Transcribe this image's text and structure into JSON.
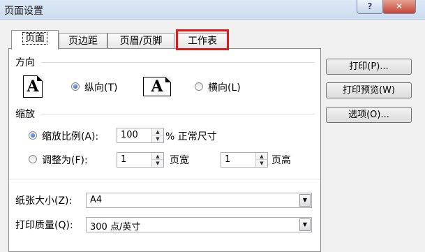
{
  "window": {
    "title": "页面设置",
    "help_label": "?",
    "close_label": "✕"
  },
  "tabs": [
    {
      "label": "页面",
      "selected": true
    },
    {
      "label": "页边距",
      "selected": false
    },
    {
      "label": "页眉/页脚",
      "selected": false
    },
    {
      "label": "工作表",
      "selected": false,
      "highlighted": true
    }
  ],
  "orientation": {
    "title": "方向",
    "icon_glyph": "A",
    "portrait_label": "纵向(T)",
    "landscape_label": "横向(L)",
    "selected": "portrait"
  },
  "scaling": {
    "title": "缩放",
    "adjust_to_label": "缩放比例(A):",
    "adjust_to_value": "100",
    "adjust_to_suffix": "% 正常尺寸",
    "fit_to_label": "调整为(F):",
    "pages_wide_value": "1",
    "pages_wide_label": "页宽",
    "pages_tall_value": "1",
    "pages_tall_label": "页高",
    "selected": "adjust_to"
  },
  "paper_size": {
    "label": "纸张大小(Z):",
    "value": "A4"
  },
  "print_quality": {
    "label": "打印质量(Q):",
    "value": "300 点/英寸"
  },
  "side_buttons": {
    "print": "打印(P)...",
    "print_preview": "打印预览(W)",
    "options": "选项(O)..."
  },
  "colors": {
    "highlight_box": "#e01818",
    "titlebar": "#cddcef"
  }
}
